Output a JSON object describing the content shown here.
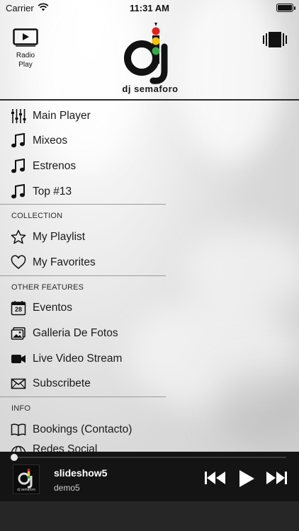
{
  "status_bar": {
    "carrier": "Carrier",
    "time": "11:31 AM",
    "battery_level": 1.0
  },
  "header": {
    "radio_label_line1": "Radio",
    "radio_label_line2": "Play",
    "logo_text_dj": "dj",
    "logo_text_brand": "semaforo"
  },
  "menu": {
    "main": [
      {
        "label": "Main Player",
        "icon": "equalizer-icon"
      },
      {
        "label": "Mixeos",
        "icon": "music-note-icon"
      },
      {
        "label": "Estrenos",
        "icon": "music-note-icon"
      },
      {
        "label": "Top #13",
        "icon": "music-note-icon"
      }
    ],
    "collection_title": "COLLECTION",
    "collection": [
      {
        "label": "My Playlist",
        "icon": "star-icon"
      },
      {
        "label": "My Favorites",
        "icon": "heart-icon"
      }
    ],
    "other_title": "OTHER FEATURES",
    "other": [
      {
        "label": "Eventos",
        "icon": "calendar-icon",
        "calendar_day": "28"
      },
      {
        "label": "Galleria De Fotos",
        "icon": "photos-icon"
      },
      {
        "label": "Live Video Stream",
        "icon": "video-camera-icon"
      },
      {
        "label": "Subscribete",
        "icon": "envelope-icon"
      }
    ],
    "info_title": "INFO",
    "info": [
      {
        "label": "Bookings (Contacto)",
        "icon": "book-icon"
      },
      {
        "label": "Redes Social",
        "icon": "globe-icon"
      }
    ]
  },
  "player": {
    "title": "slideshow5",
    "artist": "demo5",
    "progress": 0.0,
    "thumb_text": "dj semaforo"
  },
  "colors": {
    "player_bg": "#141414",
    "light_red": "#e0231a",
    "light_yellow": "#f2c300",
    "light_green": "#3aa84a"
  }
}
